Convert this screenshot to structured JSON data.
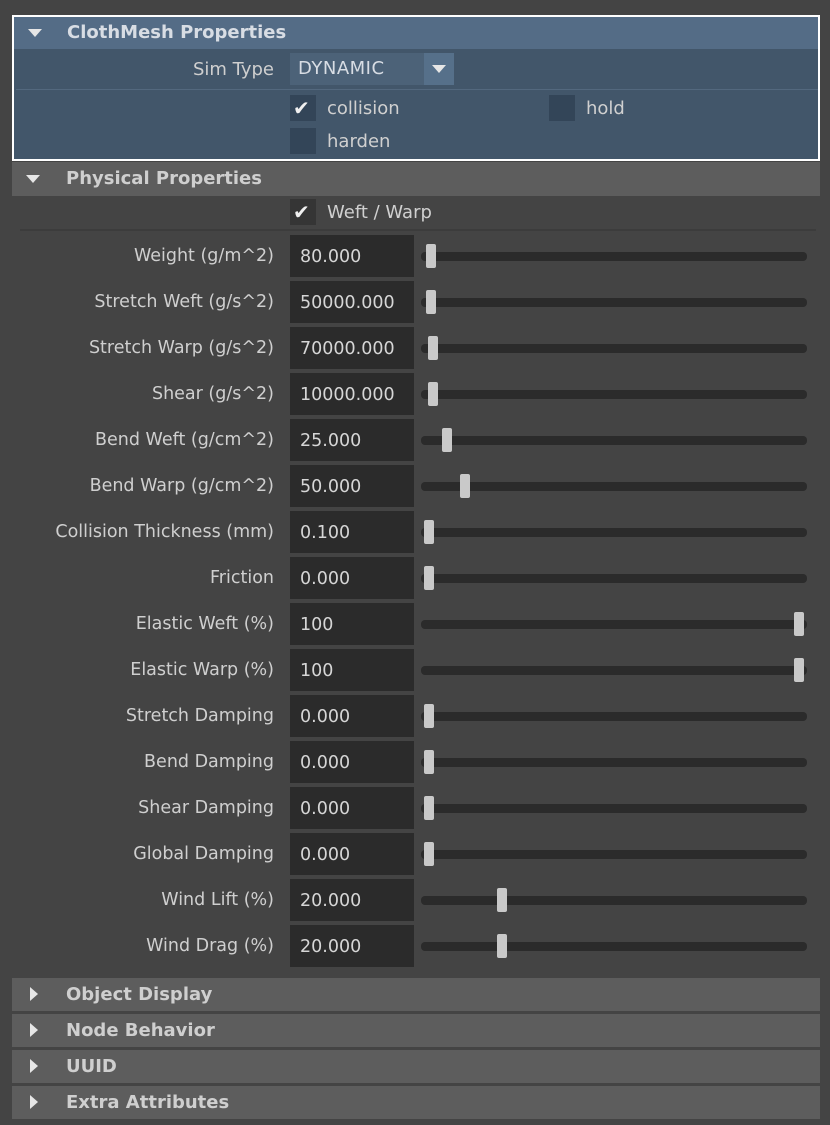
{
  "cloth_mesh": {
    "title": "ClothMesh Properties",
    "sim_type_label": "Sim Type",
    "sim_type_value": "DYNAMIC",
    "collision_label": "collision",
    "collision_checked": true,
    "hold_label": "hold",
    "hold_checked": false,
    "harden_label": "harden",
    "harden_checked": false
  },
  "physical": {
    "title": "Physical Properties",
    "weft_warp_label": "Weft / Warp",
    "weft_warp_checked": true,
    "rows": [
      {
        "label": "Weight (g/m^2)",
        "value": "80.000",
        "slider": 0.025
      },
      {
        "label": "Stretch Weft (g/s^2)",
        "value": "50000.000",
        "slider": 0.025
      },
      {
        "label": "Stretch Warp (g/s^2)",
        "value": "70000.000",
        "slider": 0.03
      },
      {
        "label": "Shear (g/s^2)",
        "value": "10000.000",
        "slider": 0.03
      },
      {
        "label": "Bend Weft (g/cm^2)",
        "value": "25.000",
        "slider": 0.068
      },
      {
        "label": "Bend Warp (g/cm^2)",
        "value": "50.000",
        "slider": 0.115
      },
      {
        "label": "Collision Thickness (mm)",
        "value": "0.100",
        "slider": 0.02
      },
      {
        "label": "Friction",
        "value": "0.000",
        "slider": 0.02
      },
      {
        "label": "Elastic Weft (%)",
        "value": "100",
        "slider": 0.98
      },
      {
        "label": "Elastic Warp (%)",
        "value": "100",
        "slider": 0.98
      },
      {
        "label": "Stretch Damping",
        "value": "0.000",
        "slider": 0.02
      },
      {
        "label": "Bend Damping",
        "value": "0.000",
        "slider": 0.02
      },
      {
        "label": "Shear Damping",
        "value": "0.000",
        "slider": 0.02
      },
      {
        "label": "Global Damping",
        "value": "0.000",
        "slider": 0.02
      },
      {
        "label": "Wind Lift (%)",
        "value": "20.000",
        "slider": 0.21
      },
      {
        "label": "Wind Drag (%)",
        "value": "20.000",
        "slider": 0.21
      }
    ]
  },
  "collapsed_sections": [
    {
      "title": "Object Display"
    },
    {
      "title": "Node Behavior"
    },
    {
      "title": "UUID"
    },
    {
      "title": "Extra Attributes"
    }
  ],
  "colors": {
    "background": "#444444",
    "highlight_section": "#42566a",
    "highlight_header": "#546c86",
    "field_bg": "#2b2b2b",
    "header_bg": "#5d5d5d"
  }
}
